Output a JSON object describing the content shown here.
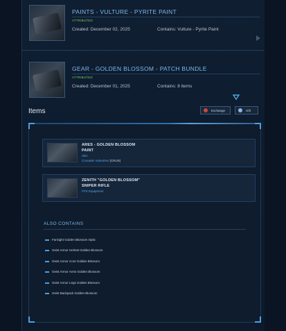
{
  "pledges": [
    {
      "title": "PAINTS - VULTURE - PYRITE PAINT",
      "status": "ATTRIBUTED",
      "created": "Created: December 02, 2025",
      "contains": "Contains: Vulture - Pyrite Paint"
    },
    {
      "title": "GEAR - GOLDEN BLOSSOM - PATCH BUNDLE",
      "status": "ATTRIBUTED",
      "created": "Created: December 01, 2025",
      "contains": "Contains: 8 items"
    }
  ],
  "items_section": {
    "title": "Items",
    "exchange_label": "Exchange",
    "gift_label": "Gift"
  },
  "items": [
    {
      "name_line1": "ARES - GOLDEN BLOSSOM",
      "name_line2": "PAINT",
      "type": "Skin",
      "manufacturer": "Crusader Industries",
      "manufacturer_code": "(CRUS)"
    },
    {
      "name_line1": "ZENITH \"GOLDEN BLOSSOM\"",
      "name_line2": "SNIPER RIFLE",
      "type": "FPS Equipment"
    }
  ],
  "also_contains": {
    "title": "ALSO CONTAINS",
    "items": [
      "FarSight Golden Blossom Optic",
      "Geist Armor Helmet Golden Blossom",
      "Geist Armor Core Golden Blossom",
      "Geist Armor Arms Golden Blossom",
      "Geist Armor Legs Golden Blossom",
      "Geist Backpack Golden Blossom"
    ]
  },
  "colors": {
    "accent": "#7fb8ea",
    "attributed": "#7bd15c",
    "link": "#4fa6e8",
    "background": "#0b1626"
  }
}
